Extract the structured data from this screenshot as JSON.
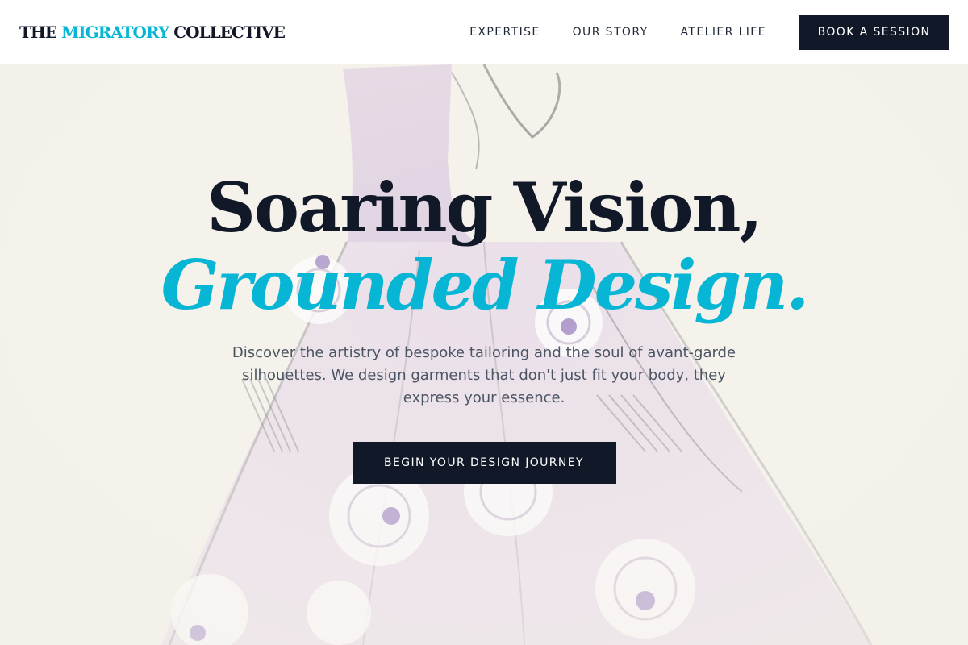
{
  "brand": {
    "prefix": "THE",
    "highlight": "MIGRATORY",
    "suffix": "COLLECTIVE"
  },
  "nav": {
    "items": [
      {
        "label": "EXPERTISE"
      },
      {
        "label": "OUR STORY"
      },
      {
        "label": "ATELIER LIFE"
      }
    ],
    "cta_label": "BOOK A SESSION"
  },
  "hero": {
    "title_line1": "Soaring Vision,",
    "title_line2": "Grounded Design.",
    "subtitle": "Discover the artistry of bespoke tailoring and the soul of avant-garde silhouettes. We design garments that don't just fit your body, they express your essence.",
    "cta_label": "BEGIN YOUR DESIGN JOURNEY"
  },
  "colors": {
    "accent": "#06b6d4",
    "dark": "#111827",
    "background": "#f6f3ee",
    "body_text": "#4b5563"
  },
  "background_image": "sketch-ballgown-illustration"
}
